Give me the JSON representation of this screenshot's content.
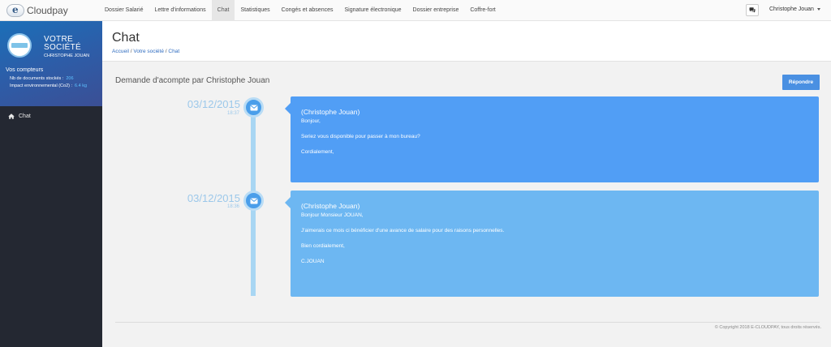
{
  "brand": {
    "name": "Cloudpay"
  },
  "nav": {
    "items": [
      {
        "label": "Dossier Salarié"
      },
      {
        "label": "Lettre d'informations"
      },
      {
        "label": "Chat"
      },
      {
        "label": "Statistiques"
      },
      {
        "label": "Congés et absences"
      },
      {
        "label": "Signature électronique"
      },
      {
        "label": "Dossier entreprise"
      },
      {
        "label": "Coffre-fort"
      }
    ],
    "active": "Chat",
    "user": "Christophe Jouan"
  },
  "sidebar": {
    "company_name": "VOTRE SOCIÉTÉ",
    "company_user": "CHRISTOPHE JOUAN",
    "counters_title": "Vos compteurs",
    "counters": [
      {
        "label": "Nb de documents stockés :",
        "value": "206"
      },
      {
        "label": "Impact environnemental (Co2) :",
        "value": "6.4 kg"
      }
    ],
    "menu": [
      {
        "label": "Chat",
        "icon": "home-icon"
      }
    ]
  },
  "page": {
    "title": "Chat",
    "breadcrumb": [
      "Accueil",
      "Votre société",
      "Chat"
    ],
    "section_title": "Demande d'acompte par Christophe Jouan",
    "reply_label": "Répondre"
  },
  "messages": [
    {
      "date": "03/12/2015",
      "time": "18:37",
      "author": "(Christophe Jouan)",
      "lines": [
        "Bonjour,",
        "",
        "Seriez vous disponible pour passer à mon bureau?",
        "",
        "Cordialement,"
      ]
    },
    {
      "date": "03/12/2015",
      "time": "18:36",
      "author": "(Christophe Jouan)",
      "lines": [
        "Bonjour Monsieur JOUAN,",
        "",
        "J'aimerais ce mois ci bénéficier d'une avance de salaire pour des raisons personnelles.",
        "",
        "Bien cordialement,",
        "",
        "C.JOUAN"
      ]
    }
  ],
  "colors": {
    "message_1": "#519ef5",
    "message_2": "#6db7f2",
    "timeline": "#a8d6f3",
    "button": "#4a90e2",
    "sidebar": "#242832"
  },
  "footer": {
    "copyright": "© Copyright 2018 E-CLOUDPAY, tous droits réservés."
  }
}
